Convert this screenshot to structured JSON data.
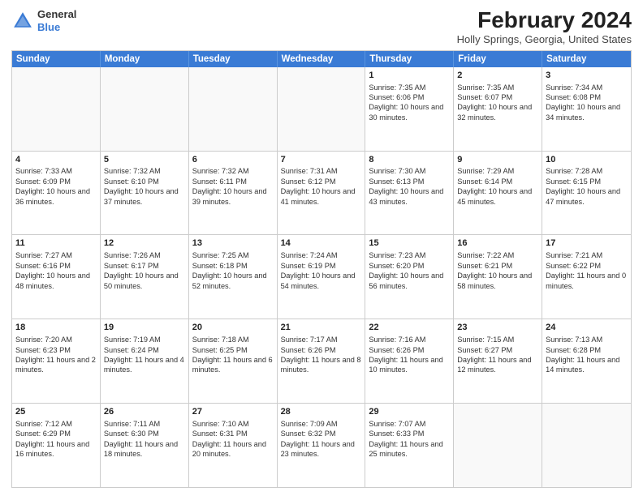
{
  "header": {
    "logo_general": "General",
    "logo_blue": "Blue",
    "month_year": "February 2024",
    "location": "Holly Springs, Georgia, United States"
  },
  "days_of_week": [
    "Sunday",
    "Monday",
    "Tuesday",
    "Wednesday",
    "Thursday",
    "Friday",
    "Saturday"
  ],
  "weeks": [
    [
      {
        "day": "",
        "sunrise": "",
        "sunset": "",
        "daylight": ""
      },
      {
        "day": "",
        "sunrise": "",
        "sunset": "",
        "daylight": ""
      },
      {
        "day": "",
        "sunrise": "",
        "sunset": "",
        "daylight": ""
      },
      {
        "day": "",
        "sunrise": "",
        "sunset": "",
        "daylight": ""
      },
      {
        "day": "1",
        "sunrise": "Sunrise: 7:35 AM",
        "sunset": "Sunset: 6:06 PM",
        "daylight": "Daylight: 10 hours and 30 minutes."
      },
      {
        "day": "2",
        "sunrise": "Sunrise: 7:35 AM",
        "sunset": "Sunset: 6:07 PM",
        "daylight": "Daylight: 10 hours and 32 minutes."
      },
      {
        "day": "3",
        "sunrise": "Sunrise: 7:34 AM",
        "sunset": "Sunset: 6:08 PM",
        "daylight": "Daylight: 10 hours and 34 minutes."
      }
    ],
    [
      {
        "day": "4",
        "sunrise": "Sunrise: 7:33 AM",
        "sunset": "Sunset: 6:09 PM",
        "daylight": "Daylight: 10 hours and 36 minutes."
      },
      {
        "day": "5",
        "sunrise": "Sunrise: 7:32 AM",
        "sunset": "Sunset: 6:10 PM",
        "daylight": "Daylight: 10 hours and 37 minutes."
      },
      {
        "day": "6",
        "sunrise": "Sunrise: 7:32 AM",
        "sunset": "Sunset: 6:11 PM",
        "daylight": "Daylight: 10 hours and 39 minutes."
      },
      {
        "day": "7",
        "sunrise": "Sunrise: 7:31 AM",
        "sunset": "Sunset: 6:12 PM",
        "daylight": "Daylight: 10 hours and 41 minutes."
      },
      {
        "day": "8",
        "sunrise": "Sunrise: 7:30 AM",
        "sunset": "Sunset: 6:13 PM",
        "daylight": "Daylight: 10 hours and 43 minutes."
      },
      {
        "day": "9",
        "sunrise": "Sunrise: 7:29 AM",
        "sunset": "Sunset: 6:14 PM",
        "daylight": "Daylight: 10 hours and 45 minutes."
      },
      {
        "day": "10",
        "sunrise": "Sunrise: 7:28 AM",
        "sunset": "Sunset: 6:15 PM",
        "daylight": "Daylight: 10 hours and 47 minutes."
      }
    ],
    [
      {
        "day": "11",
        "sunrise": "Sunrise: 7:27 AM",
        "sunset": "Sunset: 6:16 PM",
        "daylight": "Daylight: 10 hours and 48 minutes."
      },
      {
        "day": "12",
        "sunrise": "Sunrise: 7:26 AM",
        "sunset": "Sunset: 6:17 PM",
        "daylight": "Daylight: 10 hours and 50 minutes."
      },
      {
        "day": "13",
        "sunrise": "Sunrise: 7:25 AM",
        "sunset": "Sunset: 6:18 PM",
        "daylight": "Daylight: 10 hours and 52 minutes."
      },
      {
        "day": "14",
        "sunrise": "Sunrise: 7:24 AM",
        "sunset": "Sunset: 6:19 PM",
        "daylight": "Daylight: 10 hours and 54 minutes."
      },
      {
        "day": "15",
        "sunrise": "Sunrise: 7:23 AM",
        "sunset": "Sunset: 6:20 PM",
        "daylight": "Daylight: 10 hours and 56 minutes."
      },
      {
        "day": "16",
        "sunrise": "Sunrise: 7:22 AM",
        "sunset": "Sunset: 6:21 PM",
        "daylight": "Daylight: 10 hours and 58 minutes."
      },
      {
        "day": "17",
        "sunrise": "Sunrise: 7:21 AM",
        "sunset": "Sunset: 6:22 PM",
        "daylight": "Daylight: 11 hours and 0 minutes."
      }
    ],
    [
      {
        "day": "18",
        "sunrise": "Sunrise: 7:20 AM",
        "sunset": "Sunset: 6:23 PM",
        "daylight": "Daylight: 11 hours and 2 minutes."
      },
      {
        "day": "19",
        "sunrise": "Sunrise: 7:19 AM",
        "sunset": "Sunset: 6:24 PM",
        "daylight": "Daylight: 11 hours and 4 minutes."
      },
      {
        "day": "20",
        "sunrise": "Sunrise: 7:18 AM",
        "sunset": "Sunset: 6:25 PM",
        "daylight": "Daylight: 11 hours and 6 minutes."
      },
      {
        "day": "21",
        "sunrise": "Sunrise: 7:17 AM",
        "sunset": "Sunset: 6:26 PM",
        "daylight": "Daylight: 11 hours and 8 minutes."
      },
      {
        "day": "22",
        "sunrise": "Sunrise: 7:16 AM",
        "sunset": "Sunset: 6:26 PM",
        "daylight": "Daylight: 11 hours and 10 minutes."
      },
      {
        "day": "23",
        "sunrise": "Sunrise: 7:15 AM",
        "sunset": "Sunset: 6:27 PM",
        "daylight": "Daylight: 11 hours and 12 minutes."
      },
      {
        "day": "24",
        "sunrise": "Sunrise: 7:13 AM",
        "sunset": "Sunset: 6:28 PM",
        "daylight": "Daylight: 11 hours and 14 minutes."
      }
    ],
    [
      {
        "day": "25",
        "sunrise": "Sunrise: 7:12 AM",
        "sunset": "Sunset: 6:29 PM",
        "daylight": "Daylight: 11 hours and 16 minutes."
      },
      {
        "day": "26",
        "sunrise": "Sunrise: 7:11 AM",
        "sunset": "Sunset: 6:30 PM",
        "daylight": "Daylight: 11 hours and 18 minutes."
      },
      {
        "day": "27",
        "sunrise": "Sunrise: 7:10 AM",
        "sunset": "Sunset: 6:31 PM",
        "daylight": "Daylight: 11 hours and 20 minutes."
      },
      {
        "day": "28",
        "sunrise": "Sunrise: 7:09 AM",
        "sunset": "Sunset: 6:32 PM",
        "daylight": "Daylight: 11 hours and 23 minutes."
      },
      {
        "day": "29",
        "sunrise": "Sunrise: 7:07 AM",
        "sunset": "Sunset: 6:33 PM",
        "daylight": "Daylight: 11 hours and 25 minutes."
      },
      {
        "day": "",
        "sunrise": "",
        "sunset": "",
        "daylight": ""
      },
      {
        "day": "",
        "sunrise": "",
        "sunset": "",
        "daylight": ""
      }
    ]
  ]
}
